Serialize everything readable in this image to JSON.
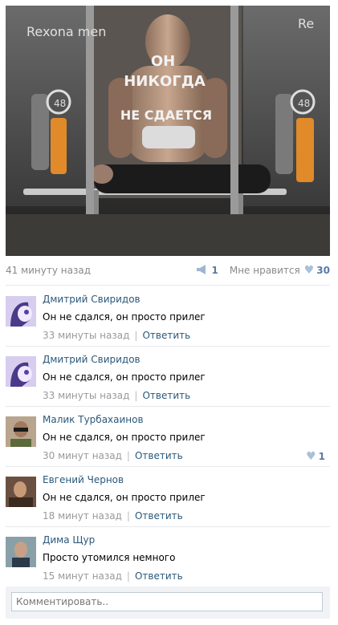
{
  "post": {
    "image_alt_icon": "photo-bus-stop-ad",
    "ad_text_lines": [
      "ОН",
      "НИКОГДА",
      "НЕ СДАЕТСЯ"
    ],
    "brand_left": "Rexona men",
    "brand_right": "Re",
    "badge": "48",
    "time": "41 минуту назад",
    "share_count": "1",
    "like_label": "Мне нравится",
    "like_count": "30"
  },
  "comments": [
    {
      "author": "Дмитрий Свиридов",
      "text": "Он не сдался, он просто прилег",
      "time": "33 минуты назад",
      "reply": "Ответить",
      "likes": ""
    },
    {
      "author": "Дмитрий Свиридов",
      "text": "Он не сдался, он просто прилег",
      "time": "33 минуты назад",
      "reply": "Ответить",
      "likes": ""
    },
    {
      "author": "Малик Турбахаинов",
      "text": "Он не сдался, он просто прилег",
      "time": "30 минут назад",
      "reply": "Ответить",
      "likes": "1"
    },
    {
      "author": "Евгений Чернов",
      "text": "Он не сдался, он просто прилег",
      "time": "18 минут назад",
      "reply": "Ответить",
      "likes": ""
    },
    {
      "author": "Дима Щур",
      "text": "Просто утомился немного",
      "time": "15 минут назад",
      "reply": "Ответить",
      "likes": ""
    }
  ],
  "comment_box": {
    "placeholder": "Комментировать.."
  },
  "colors": {
    "link": "#2b587a",
    "accent": "#5a7aa6",
    "meta": "#999999"
  }
}
